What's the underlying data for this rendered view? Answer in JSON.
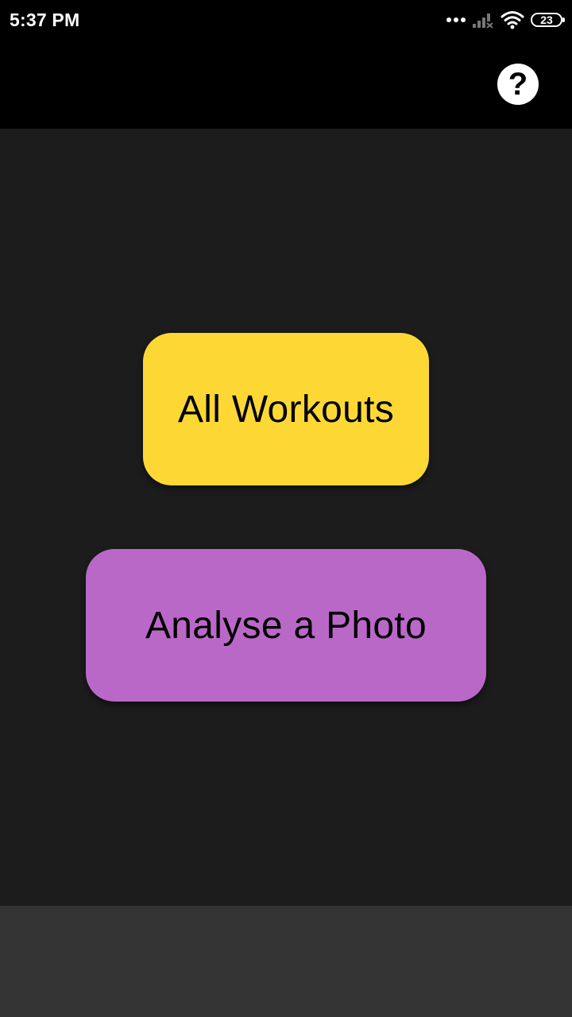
{
  "status_bar": {
    "time": "5:37 PM",
    "battery": "23"
  },
  "app_bar": {
    "help_icon_glyph": "?"
  },
  "main": {
    "workouts_button_label": "All Workouts",
    "photo_button_label": "Analyse a Photo"
  },
  "colors": {
    "workouts_button": "#fdd835",
    "photo_button": "#ba68c8",
    "background": "#1c1c1c",
    "bottom_bar": "#333333"
  },
  "icons": [
    "more-dots-icon",
    "signal-icon",
    "wifi-icon",
    "battery-icon",
    "help-icon"
  ]
}
